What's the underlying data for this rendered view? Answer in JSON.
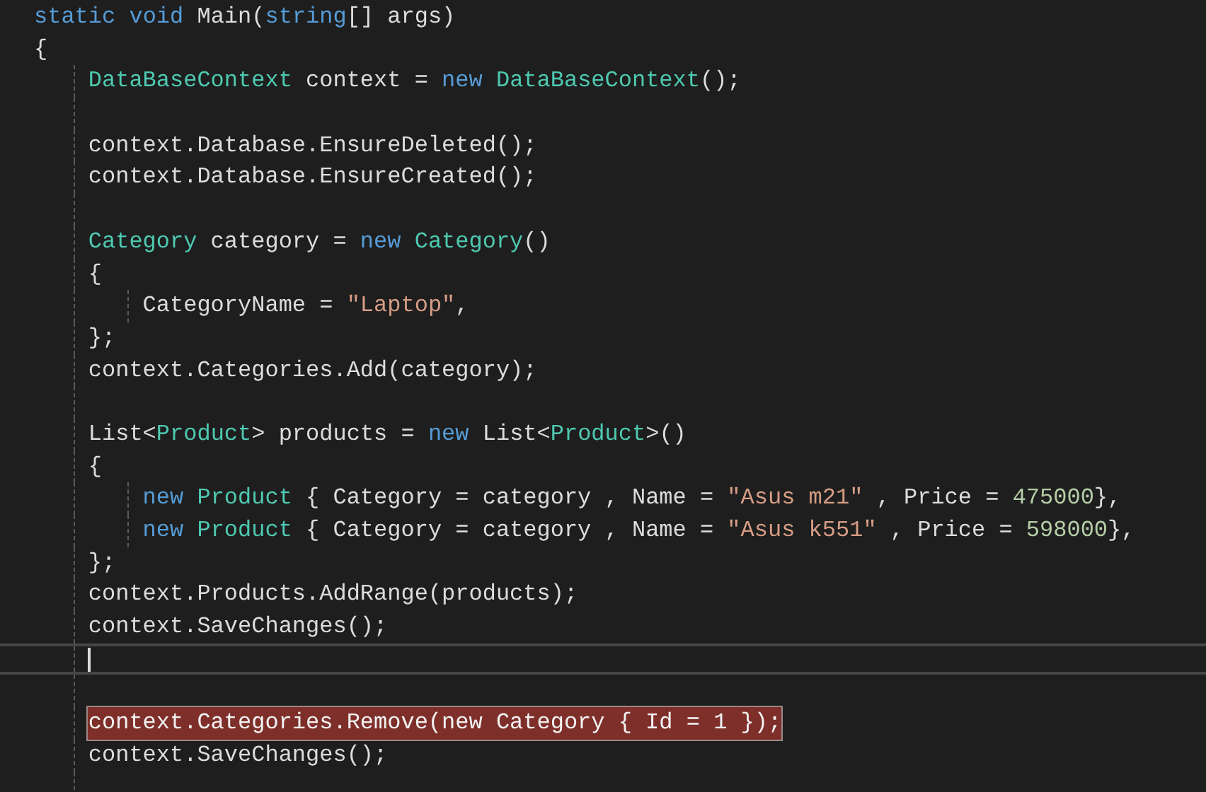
{
  "editor": {
    "lines": [
      {
        "tokens": [
          {
            "text": "static",
            "kind": "keyword"
          },
          {
            "text": " void",
            "kind": "keyword"
          },
          {
            "text": " Main(",
            "kind": "plain"
          },
          {
            "text": "string",
            "kind": "keyword"
          },
          {
            "text": "[] args)",
            "kind": "plain"
          }
        ],
        "current": false,
        "highlighted": false
      },
      {
        "tokens": [
          {
            "text": "{",
            "kind": "plain"
          }
        ],
        "current": false,
        "highlighted": false,
        "children": [
          {
            "tokens": [
              {
                "text": "DataBaseContext",
                "kind": "type"
              },
              {
                "text": " context = ",
                "kind": "plain"
              },
              {
                "text": "new",
                "kind": "keyword"
              },
              {
                "text": " DataBaseContext",
                "kind": "type"
              },
              {
                "text": "();",
                "kind": "plain"
              }
            ],
            "current": false,
            "highlighted": false
          },
          {
            "current": false,
            "highlighted": false
          },
          {
            "tokens": [
              {
                "text": "context.Database.EnsureDeleted();",
                "kind": "plain"
              }
            ],
            "current": false,
            "highlighted": false
          },
          {
            "tokens": [
              {
                "text": "context.Database.EnsureCreated();",
                "kind": "plain"
              }
            ],
            "current": false,
            "highlighted": false
          },
          {
            "current": false,
            "highlighted": false
          },
          {
            "tokens": [
              {
                "text": "Category",
                "kind": "type"
              },
              {
                "text": " category = ",
                "kind": "plain"
              },
              {
                "text": "new",
                "kind": "keyword"
              },
              {
                "text": " Category",
                "kind": "type"
              },
              {
                "text": "()",
                "kind": "plain"
              }
            ],
            "current": false,
            "highlighted": false
          },
          {
            "tokens": [
              {
                "text": "{",
                "kind": "plain"
              }
            ],
            "current": false,
            "highlighted": false,
            "children": [
              {
                "tokens": [
                  {
                    "text": "CategoryName = ",
                    "kind": "plain"
                  },
                  {
                    "text": "\"Laptop\"",
                    "kind": "string"
                  },
                  {
                    "text": ",",
                    "kind": "plain"
                  }
                ],
                "current": false,
                "highlighted": false
              }
            ]
          },
          {
            "tokens": [
              {
                "text": "};",
                "kind": "plain"
              }
            ],
            "current": false,
            "highlighted": false
          },
          {
            "tokens": [
              {
                "text": "context.Categories.Add(category);",
                "kind": "plain"
              }
            ],
            "current": false,
            "highlighted": false
          },
          {
            "current": false,
            "highlighted": false
          },
          {
            "tokens": [
              {
                "text": "List<",
                "kind": "plain"
              },
              {
                "text": "Product",
                "kind": "type"
              },
              {
                "text": "> products = ",
                "kind": "plain"
              },
              {
                "text": "new",
                "kind": "keyword"
              },
              {
                "text": " List<",
                "kind": "plain"
              },
              {
                "text": "Product",
                "kind": "type"
              },
              {
                "text": ">()",
                "kind": "plain"
              }
            ],
            "current": false,
            "highlighted": false
          },
          {
            "tokens": [
              {
                "text": "{",
                "kind": "plain"
              }
            ],
            "current": false,
            "highlighted": false,
            "children": [
              {
                "tokens": [
                  {
                    "text": "new",
                    "kind": "keyword"
                  },
                  {
                    "text": " Product",
                    "kind": "type"
                  },
                  {
                    "text": " { Category = category , Name = ",
                    "kind": "plain"
                  },
                  {
                    "text": "\"Asus m21\"",
                    "kind": "string"
                  },
                  {
                    "text": " , Price = ",
                    "kind": "plain"
                  },
                  {
                    "text": "475000",
                    "kind": "number"
                  },
                  {
                    "text": "},",
                    "kind": "plain"
                  }
                ],
                "current": false,
                "highlighted": false
              },
              {
                "tokens": [
                  {
                    "text": "new",
                    "kind": "keyword"
                  },
                  {
                    "text": " Product",
                    "kind": "type"
                  },
                  {
                    "text": " { Category = category , Name = ",
                    "kind": "plain"
                  },
                  {
                    "text": "\"Asus k551\"",
                    "kind": "string"
                  },
                  {
                    "text": " , Price = ",
                    "kind": "plain"
                  },
                  {
                    "text": "598000",
                    "kind": "number"
                  },
                  {
                    "text": "},",
                    "kind": "plain"
                  }
                ],
                "current": false,
                "highlighted": false
              }
            ]
          },
          {
            "tokens": [
              {
                "text": "};",
                "kind": "plain"
              }
            ],
            "current": false,
            "highlighted": false
          },
          {
            "tokens": [
              {
                "text": "context.Products.AddRange(products);",
                "kind": "plain"
              }
            ],
            "current": false,
            "highlighted": false
          },
          {
            "tokens": [
              {
                "text": "context.SaveChanges();",
                "kind": "plain"
              }
            ],
            "current": false,
            "highlighted": false
          },
          {
            "current": true,
            "highlighted": false
          },
          {
            "current": false,
            "highlighted": false
          },
          {
            "tokens": [
              {
                "text": "context.Categories.Remove(new Category { Id = 1 });",
                "kind": "plain"
              }
            ],
            "current": false,
            "highlighted": true
          },
          {
            "tokens": [
              {
                "text": "context.SaveChanges();",
                "kind": "plain"
              }
            ],
            "current": false,
            "highlighted": false
          },
          {
            "current": false,
            "highlighted": false
          }
        ]
      }
    ]
  }
}
